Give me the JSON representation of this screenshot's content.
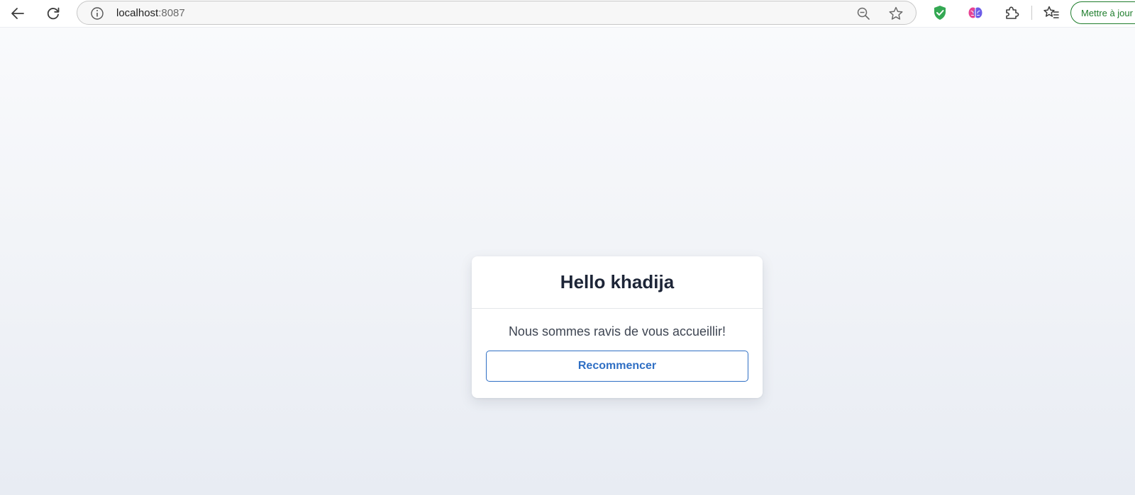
{
  "browser": {
    "url_host": "localhost",
    "url_port": ":8087",
    "update_button_label": "Mettre à jour"
  },
  "icons": {
    "back": "back-arrow-icon",
    "reload": "reload-icon",
    "site_info": "info-icon",
    "zoom": "zoom-out-icon",
    "bookmark": "star-icon",
    "extension_shield": "shield-icon",
    "extension_brain": "brain-icon",
    "extensions": "puzzle-icon",
    "favorites": "favorites-icon"
  },
  "colors": {
    "accent": "#2f6fc4",
    "title": "#1d2537",
    "update_green": "#1e7d2c",
    "shield_green": "#34a853"
  },
  "card": {
    "title": "Hello khadija",
    "message": "Nous sommes ravis de vous accueillir!",
    "button_label": "Recommencer"
  }
}
